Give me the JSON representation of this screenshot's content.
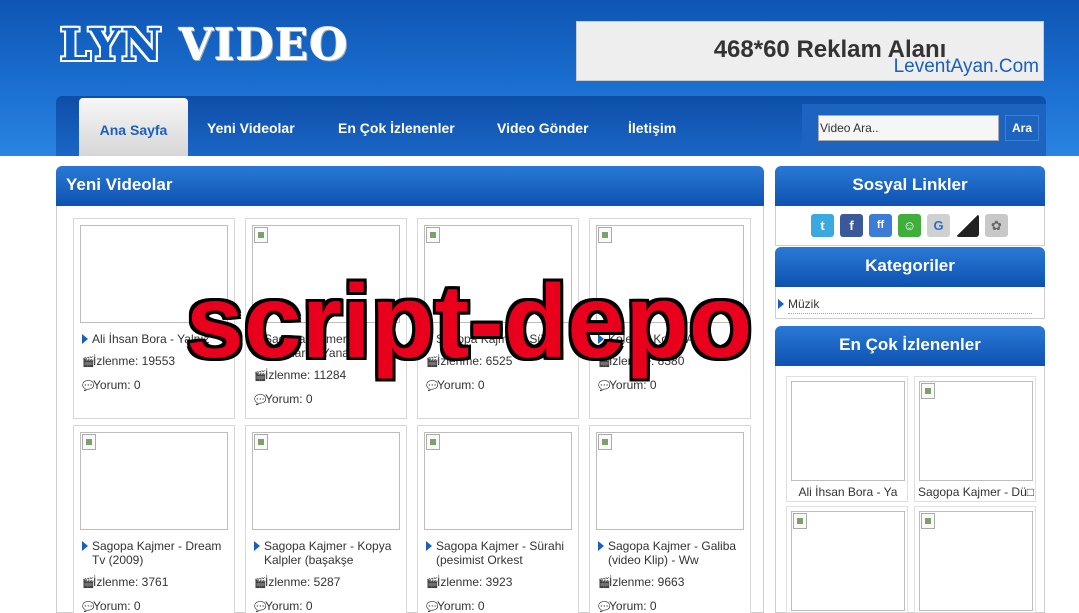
{
  "logo": {
    "part1": "LYN",
    "part2": "VIDEO"
  },
  "ad": {
    "title": "468*60 Reklam Alanı",
    "credit": "LeventAyan.Com"
  },
  "nav": {
    "items": [
      "Ana Sayfa",
      "Yeni Videolar",
      "En Çok İzlenenler",
      "Video Gönder",
      "İletişim"
    ],
    "active": "Ana Sayfa"
  },
  "search": {
    "value": "Video Ara..",
    "button": "Ara"
  },
  "main": {
    "title": "Yeni Videolar",
    "videos": [
      {
        "title": "Ali İhsan Bora - Yalnız",
        "views": "İzlenme: 19553",
        "comments": "Yorum: 0"
      },
      {
        "title": "Sagopa Kajmer - Sarkılarım Yanar",
        "views": "İzlenme: 11284",
        "comments": "Yorum: 0"
      },
      {
        "title": "Sagopa Kajmer - Sürahi",
        "views": "İzlenme: 6525",
        "comments": "Yorum: 0"
      },
      {
        "title": "Kolera - Kolay Anla",
        "views": "İzlenme: 8380",
        "comments": "Yorum: 0"
      },
      {
        "title": "Sagopa Kajmer - Dream Tv (2009)",
        "views": "İzlenme: 3761",
        "comments": "Yorum: 0"
      },
      {
        "title": "Sagopa Kajmer - Kopya Kalpler (başakşe",
        "views": "İzlenme: 5287",
        "comments": "Yorum: 0"
      },
      {
        "title": "Sagopa Kajmer - Sürahi (pesimist Orkest",
        "views": "İzlenme: 3923",
        "comments": "Yorum: 0"
      },
      {
        "title": "Sagopa Kajmer - Galiba (video Klip) - Ww",
        "views": "İzlenme: 9663",
        "comments": "Yorum: 0"
      }
    ]
  },
  "social": {
    "title": "Sosyal Linkler",
    "icons": [
      {
        "name": "twitter-icon",
        "glyph": "t",
        "color": "#3aa9e0"
      },
      {
        "name": "facebook-icon",
        "glyph": "f",
        "color": "#3b5998"
      },
      {
        "name": "friendfeed-icon",
        "glyph": "ff",
        "color": "#3c7bd6"
      },
      {
        "name": "myspace-icon",
        "glyph": "☺",
        "color": "#3fae3b"
      },
      {
        "name": "google-icon",
        "glyph": "G",
        "color": "#d0d0d0"
      },
      {
        "name": "delicious-icon",
        "glyph": "",
        "color": "#222222"
      },
      {
        "name": "stumbleupon-icon",
        "glyph": "✿",
        "color": "#c8c8c8"
      }
    ]
  },
  "categories": {
    "title": "Kategoriler",
    "items": [
      "Müzik"
    ]
  },
  "popular": {
    "title": "En Çok İzlenenler",
    "items": [
      {
        "title": "Ali İhsan Bora - Ya"
      },
      {
        "title": "Sagopa Kajmer - Dü□"
      },
      {
        "title": ""
      },
      {
        "title": ""
      }
    ]
  },
  "watermark": "script-depo",
  "colors": {
    "primary": "#1a5fc0",
    "header_top": "#0f55b4",
    "watermark": "#e8001c"
  }
}
